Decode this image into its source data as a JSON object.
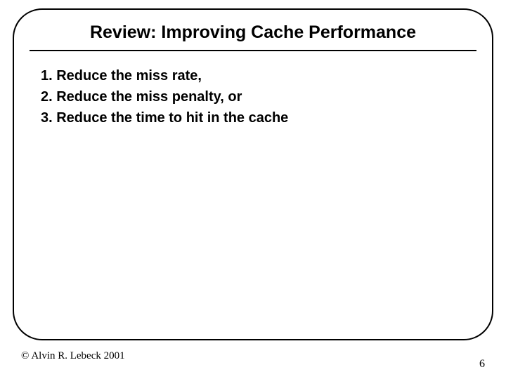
{
  "title": "Review: Improving Cache Performance",
  "items": [
    "1. Reduce the miss rate,",
    "2. Reduce the miss penalty, or",
    "3. Reduce the time to hit in the cache"
  ],
  "footer": {
    "copyright": "© Alvin R. Lebeck 2001",
    "page": "6"
  }
}
